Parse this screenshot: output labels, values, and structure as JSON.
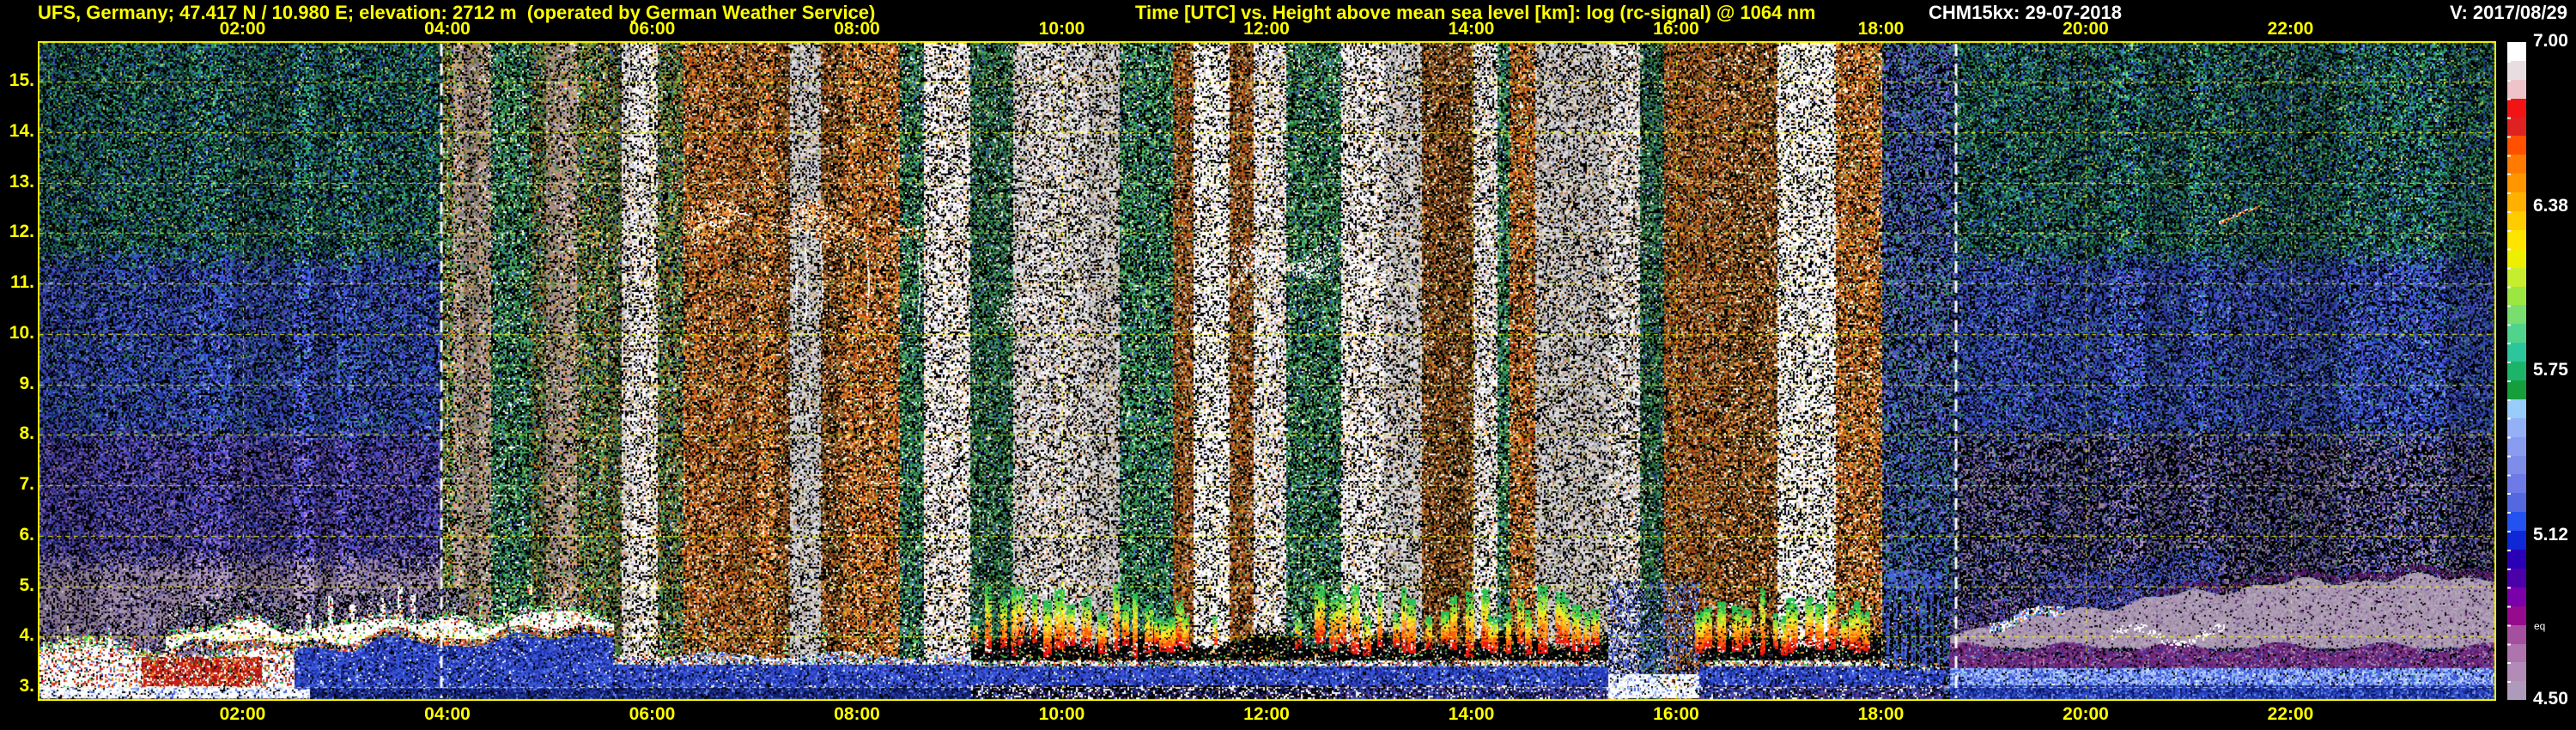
{
  "header": {
    "station": "UFS, Germany; 47.417 N / 10.980 E; elevation: 2712 m  (operated by German Weather Service)",
    "title": "Time [UTC] vs. Height above mean sea level [km]: log (rc-signal) @ 1064 nm",
    "device_date": "CHM15kx: 29-07-2018",
    "version": "V: 2017/08/29"
  },
  "colors": {
    "background": "#000000",
    "axis_text": "#ffff00",
    "header_right_text": "#ffffff",
    "plot_border": "#ffff00",
    "grid": "#ffff00",
    "sun_marker": "#ffffff"
  },
  "chart_data": {
    "type": "heatmap",
    "title": "Time [UTC] vs. Height above mean sea level [km]: log (rc-signal) @ 1064 nm",
    "xlabel": "Time [UTC]",
    "ylabel": "Height above mean sea level [km]",
    "x_range_hours": [
      0,
      24
    ],
    "x_tick_hours": [
      2,
      4,
      6,
      8,
      10,
      12,
      14,
      16,
      18,
      20,
      22
    ],
    "x_tick_labels": [
      "02:00",
      "04:00",
      "06:00",
      "08:00",
      "10:00",
      "12:00",
      "14:00",
      "16:00",
      "18:00",
      "20:00",
      "22:00"
    ],
    "y_range_km": [
      2.76,
      15.77
    ],
    "y_tick_km": [
      15,
      14,
      13,
      12,
      11,
      10,
      9,
      8,
      7,
      6,
      5,
      4,
      3
    ],
    "y_tick_labels": [
      "15.",
      "14.",
      "13.",
      "12.",
      "11.",
      "10.",
      "9.",
      "8.",
      "7.",
      "6.",
      "5.",
      "4.",
      "3."
    ],
    "grid": true,
    "colorbar": {
      "min": 4.5,
      "max": 7.0,
      "tick_labels": [
        "7.00",
        "6.38",
        "5.75",
        "5.12",
        "4.50"
      ],
      "stray_label": "eq",
      "colors": [
        "#FFFFFF",
        "#E8DEE2",
        "#EEC4CA",
        "#F21414",
        "#DE2222",
        "#FF5000",
        "#FF7A00",
        "#FF9600",
        "#FFB000",
        "#FFCC00",
        "#FFE400",
        "#EEEE00",
        "#C6EE2E",
        "#9CE642",
        "#78DE6E",
        "#50D48C",
        "#2CC69C",
        "#1CB468",
        "#169E3C",
        "#98CCFA",
        "#94B0F6",
        "#8A9CF0",
        "#7E8CEA",
        "#6E7AE6",
        "#5468E0",
        "#2452F0",
        "#0E28D8",
        "#2A00B6",
        "#4C00AA",
        "#7A00AA",
        "#960A8E",
        "#A4509E",
        "#AE74AE",
        "#B28CB6",
        "#AE9ABA"
      ]
    },
    "sun_marker_hours": [
      3.94,
      18.73
    ],
    "phenomena": {
      "boundary_blob": {
        "t": [
          0,
          2.72
        ],
        "km": [
          2.78,
          3.85
        ]
      },
      "red_patch": {
        "t": [
          1.02,
          2.18
        ],
        "km": [
          3.02,
          3.58
        ]
      },
      "cloud_line": {
        "t": [
          1.25,
          5.62
        ],
        "km_start": 3.95,
        "km_end": 4.3
      },
      "morning_layer": {
        "t": [
          5.62,
          9.12
        ],
        "km": [
          2.9,
          3.65
        ]
      },
      "convection": {
        "t": [
          9.12,
          18.05
        ],
        "km": [
          3.0,
          5.1
        ],
        "clusters": [
          [
            9.2,
            11.25
          ],
          [
            12.35,
            14.0
          ],
          [
            14.0,
            15.33
          ],
          [
            16.22,
            18.0
          ]
        ],
        "gaps": [
          [
            11.25,
            12.32
          ],
          [
            15.33,
            16.22
          ]
        ]
      },
      "dusk_streaks": {
        "t": [
          18.05,
          18.62
        ],
        "km": [
          3.3,
          5.4
        ]
      },
      "evening_layer": {
        "t": [
          18.68,
          24
        ],
        "boundary_km": [
          [
            18.68,
            4.05
          ],
          [
            19.2,
            4.3
          ],
          [
            19.8,
            4.5
          ],
          [
            20.6,
            4.72
          ],
          [
            21.6,
            5.0
          ],
          [
            22.7,
            5.12
          ],
          [
            24,
            5.18
          ]
        ],
        "crest_t": [
          19.05,
          19.8
        ],
        "blue_band_km": [
          3.02,
          3.34
        ]
      },
      "upper_clouds": [
        {
          "t": [
            6.25,
            7.1
          ],
          "km": [
            11.9,
            12.65
          ],
          "style": "orange"
        },
        {
          "t": [
            7.15,
            7.95
          ],
          "km": [
            11.8,
            12.6
          ],
          "style": "orange",
          "fall_streaks_t": [
            7.4,
            7.5,
            7.65
          ]
        },
        {
          "t": [
            8.0,
            8.7
          ],
          "km": [
            11.8,
            12.45
          ],
          "style": "orange",
          "fall_streaks_t": [
            8.1,
            8.6
          ]
        },
        {
          "t": [
            9.3,
            10.1
          ],
          "km": [
            10.2,
            11.0
          ],
          "style": "white"
        },
        {
          "t": [
            11.6,
            12.7
          ],
          "km": [
            10.9,
            11.9
          ],
          "style": "white"
        },
        {
          "t": [
            12.75,
            13.3
          ],
          "km": [
            10.8,
            11.5
          ],
          "style": "white"
        },
        {
          "t": [
            21.3,
            21.7
          ],
          "km": [
            12.2,
            12.55
          ],
          "style": "contrail"
        }
      ],
      "white_bottom_strip_t": [
        [
          0,
          2.65
        ],
        [
          15.1,
          16.22
        ]
      ],
      "dawn_mauve_columns": [
        [
          4.05,
          4.42
        ],
        [
          4.95,
          5.25
        ]
      ],
      "bright_columns": [
        [
          5.7,
          6.05
        ]
      ]
    }
  }
}
